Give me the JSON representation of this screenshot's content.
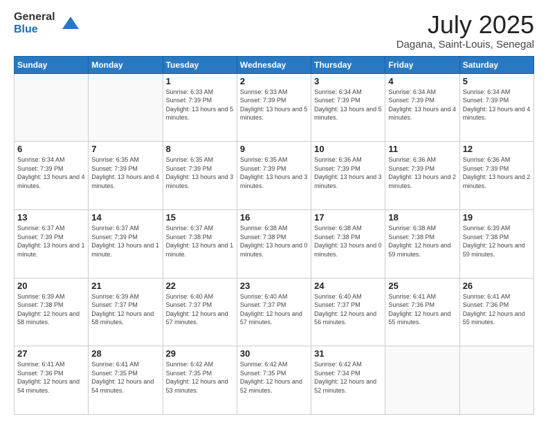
{
  "logo": {
    "general": "General",
    "blue": "Blue"
  },
  "header": {
    "month": "July 2025",
    "location": "Dagana, Saint-Louis, Senegal"
  },
  "weekdays": [
    "Sunday",
    "Monday",
    "Tuesday",
    "Wednesday",
    "Thursday",
    "Friday",
    "Saturday"
  ],
  "weeks": [
    [
      {
        "day": "",
        "sunrise": "",
        "sunset": "",
        "daylight": ""
      },
      {
        "day": "",
        "sunrise": "",
        "sunset": "",
        "daylight": ""
      },
      {
        "day": "1",
        "sunrise": "Sunrise: 6:33 AM",
        "sunset": "Sunset: 7:39 PM",
        "daylight": "Daylight: 13 hours and 5 minutes."
      },
      {
        "day": "2",
        "sunrise": "Sunrise: 6:33 AM",
        "sunset": "Sunset: 7:39 PM",
        "daylight": "Daylight: 13 hours and 5 minutes."
      },
      {
        "day": "3",
        "sunrise": "Sunrise: 6:34 AM",
        "sunset": "Sunset: 7:39 PM",
        "daylight": "Daylight: 13 hours and 5 minutes."
      },
      {
        "day": "4",
        "sunrise": "Sunrise: 6:34 AM",
        "sunset": "Sunset: 7:39 PM",
        "daylight": "Daylight: 13 hours and 4 minutes."
      },
      {
        "day": "5",
        "sunrise": "Sunrise: 6:34 AM",
        "sunset": "Sunset: 7:39 PM",
        "daylight": "Daylight: 13 hours and 4 minutes."
      }
    ],
    [
      {
        "day": "6",
        "sunrise": "Sunrise: 6:34 AM",
        "sunset": "Sunset: 7:39 PM",
        "daylight": "Daylight: 13 hours and 4 minutes."
      },
      {
        "day": "7",
        "sunrise": "Sunrise: 6:35 AM",
        "sunset": "Sunset: 7:39 PM",
        "daylight": "Daylight: 13 hours and 4 minutes."
      },
      {
        "day": "8",
        "sunrise": "Sunrise: 6:35 AM",
        "sunset": "Sunset: 7:39 PM",
        "daylight": "Daylight: 13 hours and 3 minutes."
      },
      {
        "day": "9",
        "sunrise": "Sunrise: 6:35 AM",
        "sunset": "Sunset: 7:39 PM",
        "daylight": "Daylight: 13 hours and 3 minutes."
      },
      {
        "day": "10",
        "sunrise": "Sunrise: 6:36 AM",
        "sunset": "Sunset: 7:39 PM",
        "daylight": "Daylight: 13 hours and 3 minutes."
      },
      {
        "day": "11",
        "sunrise": "Sunrise: 6:36 AM",
        "sunset": "Sunset: 7:39 PM",
        "daylight": "Daylight: 13 hours and 2 minutes."
      },
      {
        "day": "12",
        "sunrise": "Sunrise: 6:36 AM",
        "sunset": "Sunset: 7:39 PM",
        "daylight": "Daylight: 13 hours and 2 minutes."
      }
    ],
    [
      {
        "day": "13",
        "sunrise": "Sunrise: 6:37 AM",
        "sunset": "Sunset: 7:39 PM",
        "daylight": "Daylight: 13 hours and 1 minute."
      },
      {
        "day": "14",
        "sunrise": "Sunrise: 6:37 AM",
        "sunset": "Sunset: 7:39 PM",
        "daylight": "Daylight: 13 hours and 1 minute."
      },
      {
        "day": "15",
        "sunrise": "Sunrise: 6:37 AM",
        "sunset": "Sunset: 7:38 PM",
        "daylight": "Daylight: 13 hours and 1 minute."
      },
      {
        "day": "16",
        "sunrise": "Sunrise: 6:38 AM",
        "sunset": "Sunset: 7:38 PM",
        "daylight": "Daylight: 13 hours and 0 minutes."
      },
      {
        "day": "17",
        "sunrise": "Sunrise: 6:38 AM",
        "sunset": "Sunset: 7:38 PM",
        "daylight": "Daylight: 13 hours and 0 minutes."
      },
      {
        "day": "18",
        "sunrise": "Sunrise: 6:38 AM",
        "sunset": "Sunset: 7:38 PM",
        "daylight": "Daylight: 12 hours and 59 minutes."
      },
      {
        "day": "19",
        "sunrise": "Sunrise: 6:39 AM",
        "sunset": "Sunset: 7:38 PM",
        "daylight": "Daylight: 12 hours and 59 minutes."
      }
    ],
    [
      {
        "day": "20",
        "sunrise": "Sunrise: 6:39 AM",
        "sunset": "Sunset: 7:38 PM",
        "daylight": "Daylight: 12 hours and 58 minutes."
      },
      {
        "day": "21",
        "sunrise": "Sunrise: 6:39 AM",
        "sunset": "Sunset: 7:37 PM",
        "daylight": "Daylight: 12 hours and 58 minutes."
      },
      {
        "day": "22",
        "sunrise": "Sunrise: 6:40 AM",
        "sunset": "Sunset: 7:37 PM",
        "daylight": "Daylight: 12 hours and 57 minutes."
      },
      {
        "day": "23",
        "sunrise": "Sunrise: 6:40 AM",
        "sunset": "Sunset: 7:37 PM",
        "daylight": "Daylight: 12 hours and 57 minutes."
      },
      {
        "day": "24",
        "sunrise": "Sunrise: 6:40 AM",
        "sunset": "Sunset: 7:37 PM",
        "daylight": "Daylight: 12 hours and 56 minutes."
      },
      {
        "day": "25",
        "sunrise": "Sunrise: 6:41 AM",
        "sunset": "Sunset: 7:36 PM",
        "daylight": "Daylight: 12 hours and 55 minutes."
      },
      {
        "day": "26",
        "sunrise": "Sunrise: 6:41 AM",
        "sunset": "Sunset: 7:36 PM",
        "daylight": "Daylight: 12 hours and 55 minutes."
      }
    ],
    [
      {
        "day": "27",
        "sunrise": "Sunrise: 6:41 AM",
        "sunset": "Sunset: 7:36 PM",
        "daylight": "Daylight: 12 hours and 54 minutes."
      },
      {
        "day": "28",
        "sunrise": "Sunrise: 6:41 AM",
        "sunset": "Sunset: 7:35 PM",
        "daylight": "Daylight: 12 hours and 54 minutes."
      },
      {
        "day": "29",
        "sunrise": "Sunrise: 6:42 AM",
        "sunset": "Sunset: 7:35 PM",
        "daylight": "Daylight: 12 hours and 53 minutes."
      },
      {
        "day": "30",
        "sunrise": "Sunrise: 6:42 AM",
        "sunset": "Sunset: 7:35 PM",
        "daylight": "Daylight: 12 hours and 52 minutes."
      },
      {
        "day": "31",
        "sunrise": "Sunrise: 6:42 AM",
        "sunset": "Sunset: 7:34 PM",
        "daylight": "Daylight: 12 hours and 52 minutes."
      },
      {
        "day": "",
        "sunrise": "",
        "sunset": "",
        "daylight": ""
      },
      {
        "day": "",
        "sunrise": "",
        "sunset": "",
        "daylight": ""
      }
    ]
  ]
}
